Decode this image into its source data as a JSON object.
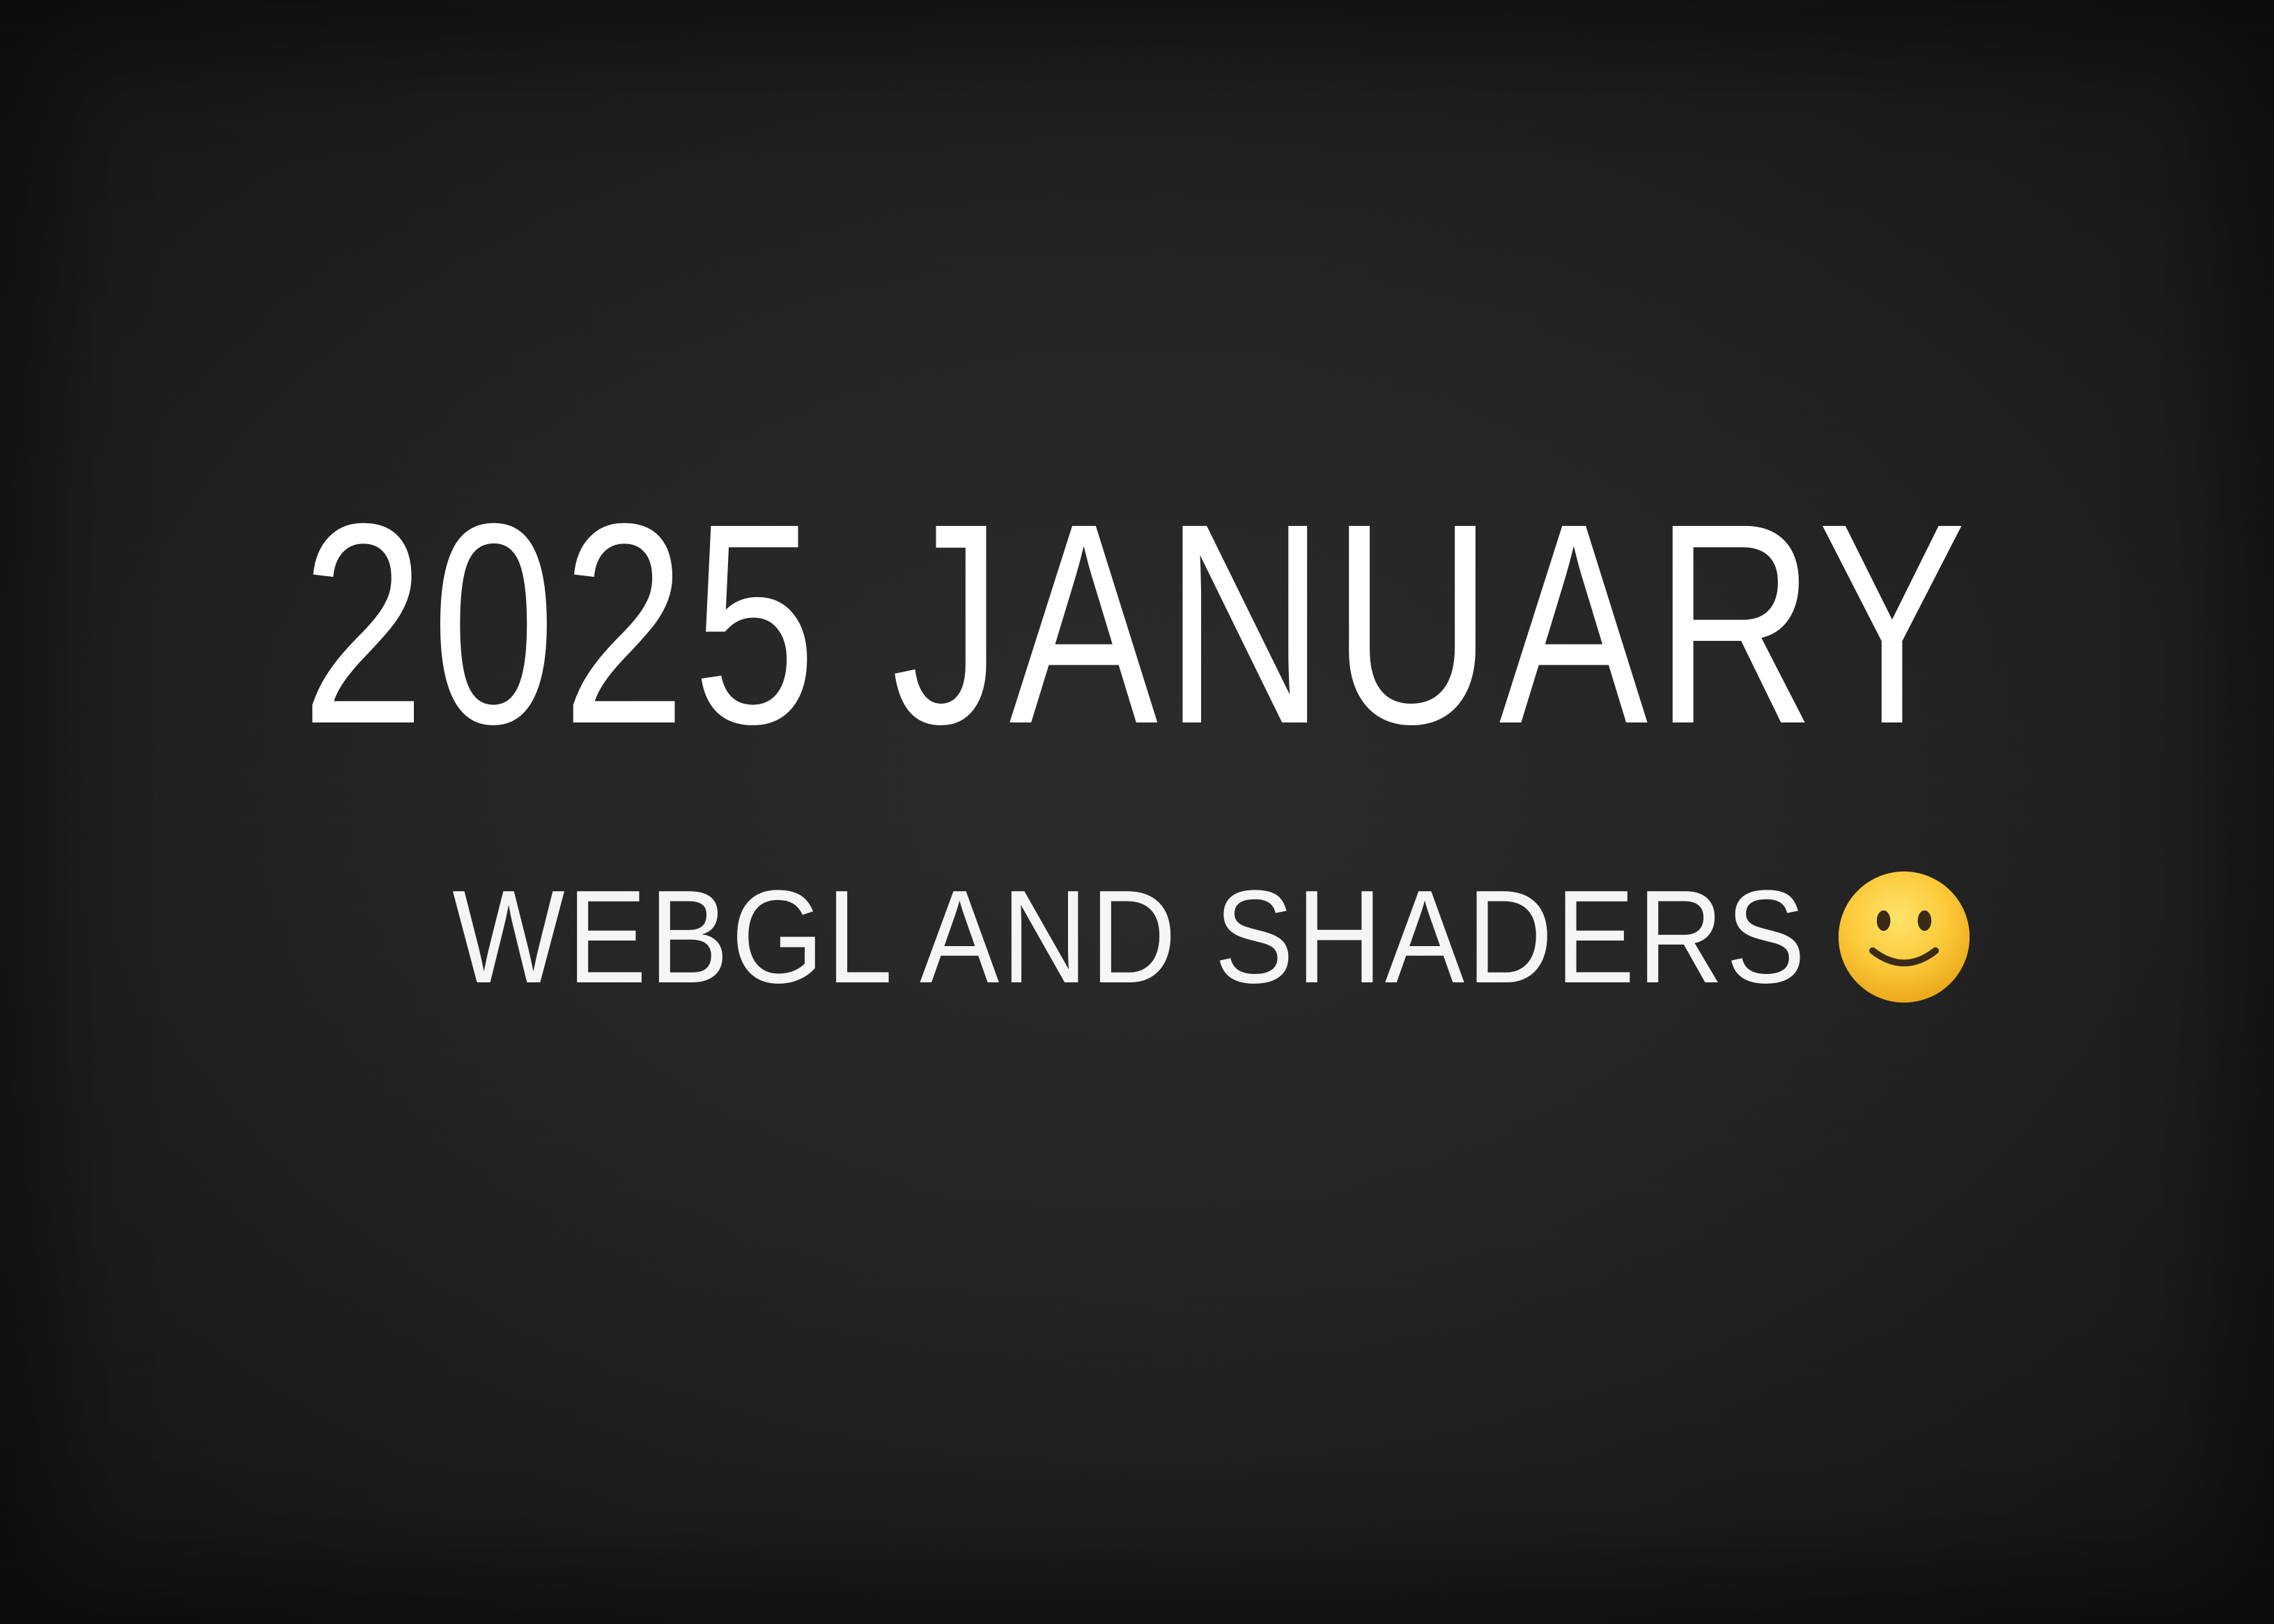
{
  "title": "2025 JANUARY",
  "subtitle": "WEBGL AND SHADERS",
  "emoji": {
    "icon": "slightly-smiling-face-icon",
    "colors": {
      "face_light": "#ffd84a",
      "face_dark": "#e9a416",
      "features": "#3a2a18"
    }
  },
  "background_color": "#242424",
  "text_color": "#ffffff"
}
